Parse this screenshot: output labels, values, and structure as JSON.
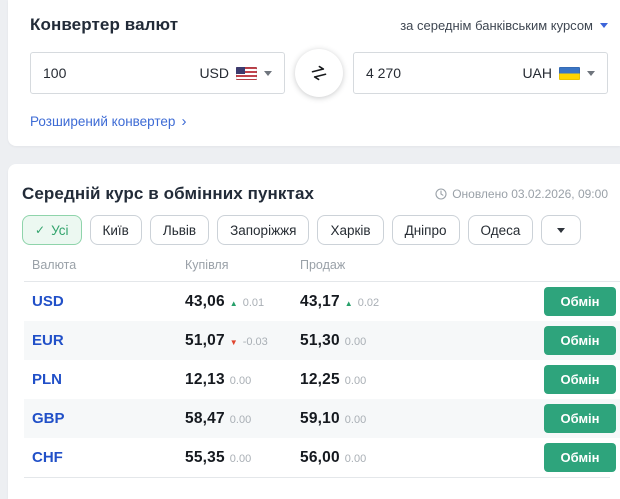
{
  "icons": {
    "check": "✓",
    "chevron_right": "›",
    "triangle_up": "▲",
    "triangle_down": "▼"
  },
  "colors": {
    "page_background": "#edeff2",
    "accent_blue": "#3c64d9",
    "link_blue": "#3d6bd5",
    "currency_blue": "#2150c8",
    "trend_up_green": "#27a06a",
    "trend_down_red": "#e0452f",
    "filter_active_green": "#33a46d",
    "exchange_button_green": "#2ea47c",
    "row_stripe": "#f6f8f9"
  },
  "converter": {
    "title": "Конвертер валют",
    "rate_source_label": "за середнім банківським курсом",
    "from": {
      "amount": "100",
      "currency": "USD",
      "flag": "us-flag"
    },
    "to": {
      "amount": "4 270",
      "currency": "UAH",
      "flag": "ua-flag"
    },
    "advanced_link_label": "Розширений конвертер"
  },
  "rates_section": {
    "title": "Середній курс в обмінних пунктах",
    "updated": "Оновлено 03.02.2026, 09:00",
    "filters": [
      {
        "label": "Усі",
        "key": "all",
        "selected": true
      },
      {
        "label": "Київ",
        "key": "kyiv",
        "selected": false
      },
      {
        "label": "Львів",
        "key": "lviv",
        "selected": false
      },
      {
        "label": "Запоріжжя",
        "key": "zaporizhzhia",
        "selected": false
      },
      {
        "label": "Харків",
        "key": "kharkiv",
        "selected": false
      },
      {
        "label": "Дніпро",
        "key": "dnipro",
        "selected": false
      },
      {
        "label": "Одеса",
        "key": "odesa",
        "selected": false
      }
    ],
    "table": {
      "headers": [
        "Валюта",
        "Купівля",
        "Продаж"
      ],
      "exchange_button_label": "Обмін",
      "rows": [
        {
          "currency": "USD",
          "buy": "43,06",
          "buy_change": "0.01",
          "buy_trend": "up",
          "sell": "43,17",
          "sell_change": "0.02",
          "sell_trend": "up"
        },
        {
          "currency": "EUR",
          "buy": "51,07",
          "buy_change": "-0.03",
          "buy_trend": "down",
          "sell": "51,30",
          "sell_change": "0.00",
          "sell_trend": "flat"
        },
        {
          "currency": "PLN",
          "buy": "12,13",
          "buy_change": "0.00",
          "buy_trend": "flat",
          "sell": "12,25",
          "sell_change": "0.00",
          "sell_trend": "flat"
        },
        {
          "currency": "GBP",
          "buy": "58,47",
          "buy_change": "0.00",
          "buy_trend": "flat",
          "sell": "59,10",
          "sell_change": "0.00",
          "sell_trend": "flat"
        },
        {
          "currency": "CHF",
          "buy": "55,35",
          "buy_change": "0.00",
          "buy_trend": "flat",
          "sell": "56,00",
          "sell_change": "0.00",
          "sell_trend": "flat"
        }
      ]
    }
  }
}
